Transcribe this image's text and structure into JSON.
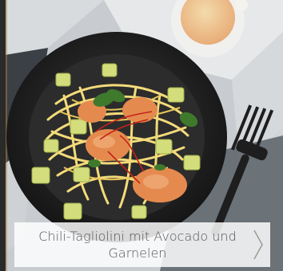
{
  "recipe": {
    "title": "Chili-Tagliolini mit Avocado und Garnelen"
  },
  "icons": {
    "next": "chevron-right-icon"
  },
  "colors": {
    "caption_background": "#ffffff",
    "caption_text": "#555555",
    "chevron": "#9a9a9a"
  }
}
